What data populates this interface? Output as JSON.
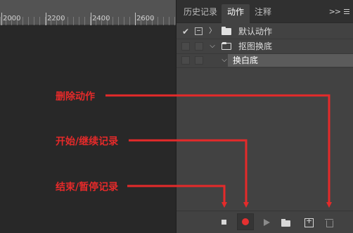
{
  "ruler": {
    "numbers": [
      "2000",
      "2200",
      "2400",
      "2600"
    ]
  },
  "panel": {
    "tabs": [
      {
        "label": "历史记录"
      },
      {
        "label": "动作"
      },
      {
        "label": "注释"
      }
    ],
    "menu_glyph": ">>",
    "actions": [
      {
        "label": "默认动作",
        "checked": true,
        "expanded": false
      },
      {
        "label": "抠图换底",
        "checked": false,
        "expanded": true
      },
      {
        "label": "换白底",
        "checked": false,
        "expanded": true,
        "selected": true
      }
    ],
    "toolbar": {
      "buttons": [
        "stop-icon",
        "record-icon",
        "play-icon",
        "folder-icon",
        "new-action-icon",
        "trash-icon"
      ]
    }
  },
  "annotations": {
    "delete": "删除动作",
    "start": "开始/继续记录",
    "stop": "结束/暂停记录",
    "color": "#e52a2a"
  }
}
